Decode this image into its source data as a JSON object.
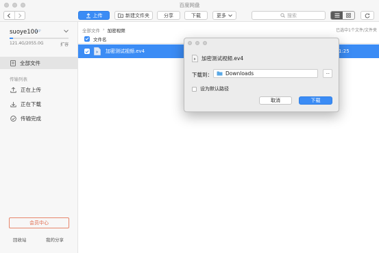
{
  "window": {
    "title": "百度网盘"
  },
  "toolbar": {
    "upload_label": "上传",
    "new_folder_label": "新建文件夹",
    "share_label": "分享",
    "download_label": "下载",
    "more_label": "更多",
    "search_placeholder": "搜索"
  },
  "sidebar": {
    "username": "suoye100",
    "vip_tag": "VIP",
    "quota_text": "121.4G/2055.0G",
    "quota_fraction": 0.059,
    "expand_label": "扩容",
    "items": [
      {
        "label": "全部文件"
      },
      {
        "label": "传输列表"
      },
      {
        "label": "正在上传"
      },
      {
        "label": "正在下载"
      },
      {
        "label": "传输完成"
      }
    ],
    "vip_center_label": "会员中心",
    "recycle_label": "回收站",
    "my_share_label": "我的分享"
  },
  "main": {
    "breadcrumb": [
      "全部文件",
      "加密视频"
    ],
    "selection_info": "已选中1个文件/文件夹",
    "columns": {
      "name": "文件名"
    },
    "files": [
      {
        "name": "加密测试视频.ev4",
        "time": "1:25"
      }
    ]
  },
  "dialog": {
    "filename": "加密测试视频.ev4",
    "download_to_label": "下载到：",
    "path": "Downloads",
    "more_button": "···",
    "default_path_label": "设为默认路径",
    "cancel_label": "取消",
    "confirm_label": "下载"
  },
  "colors": {
    "accent": "#3b8cf5",
    "vip_button": "#e06a4c",
    "selected_row": "#3b8cf5"
  }
}
